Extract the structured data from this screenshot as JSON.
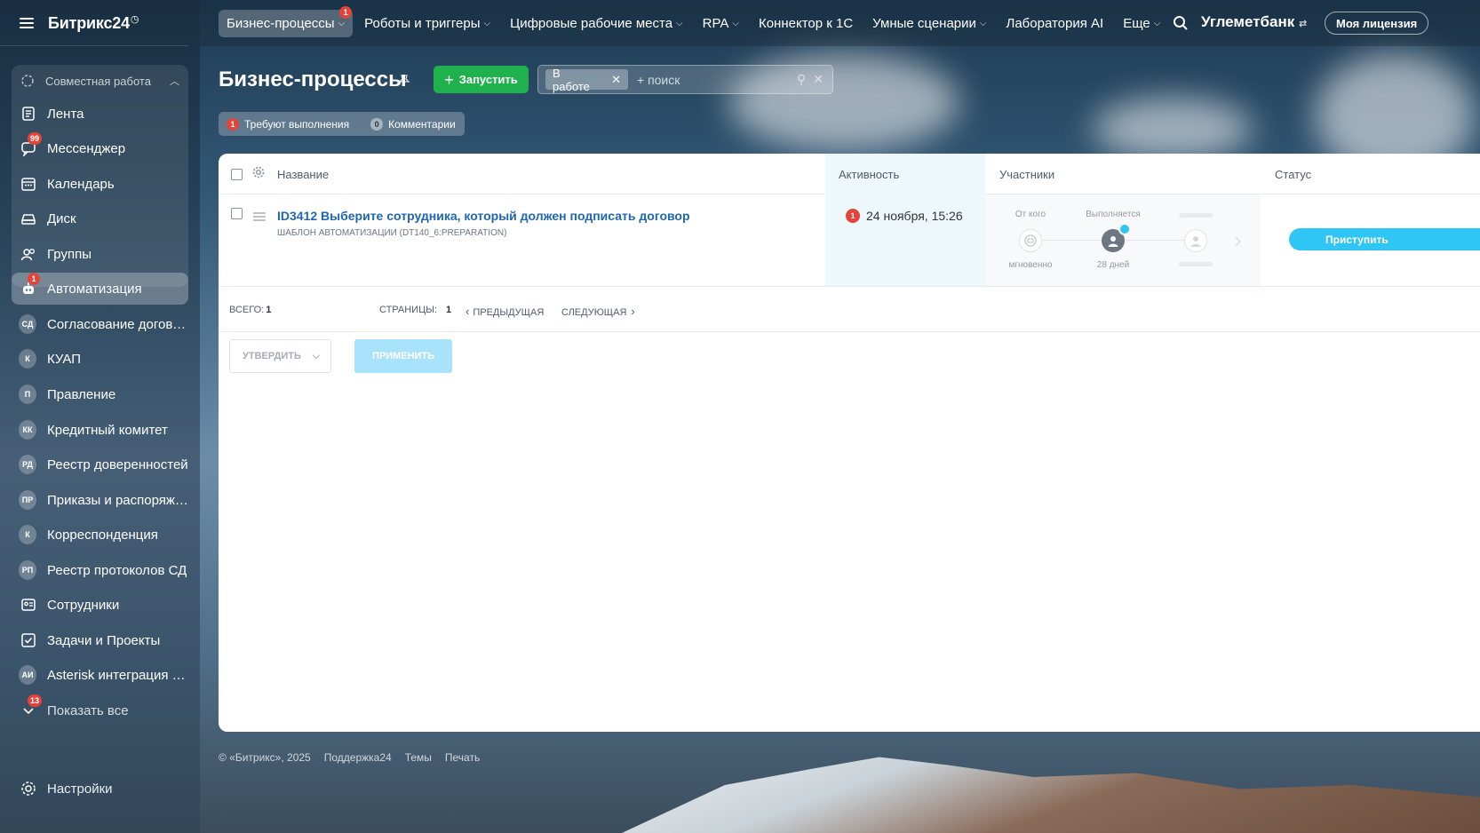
{
  "app": {
    "logo": "Битрикс24",
    "company": "Углеметбанк",
    "license_label": "Моя лицензия"
  },
  "topnav": {
    "items": [
      {
        "label": "Бизнес-процессы",
        "badge": "1",
        "active": true,
        "chevron": true
      },
      {
        "label": "Роботы и триггеры",
        "chevron": true
      },
      {
        "label": "Цифровые рабочие места",
        "chevron": true
      },
      {
        "label": "RPA",
        "chevron": true
      },
      {
        "label": "Коннектор к 1С",
        "chevron": false
      },
      {
        "label": "Умные сценарии",
        "chevron": true
      },
      {
        "label": "Лаборатория AI",
        "chevron": false
      },
      {
        "label": "Еще",
        "chevron": true
      }
    ]
  },
  "sidebar": {
    "group_label": "Совместная работа",
    "items": [
      {
        "label": "Лента",
        "icon": "feed-icon"
      },
      {
        "label": "Мессенджер",
        "icon": "messenger-icon",
        "badge": "99"
      },
      {
        "label": "Календарь",
        "icon": "calendar-icon"
      },
      {
        "label": "Диск",
        "icon": "disk-icon"
      },
      {
        "label": "Группы",
        "icon": "groups-icon"
      },
      {
        "label": "Автоматизация",
        "icon": "automation-icon",
        "badge": "1",
        "active": true
      },
      {
        "label": "Согласование догово...",
        "abbr": "СД"
      },
      {
        "label": "КУАП",
        "abbr": "К"
      },
      {
        "label": "Правление",
        "abbr": "П"
      },
      {
        "label": "Кредитный комитет",
        "abbr": "КК"
      },
      {
        "label": "Реестр доверенностей",
        "abbr": "РД"
      },
      {
        "label": "Приказы и распоряже...",
        "abbr": "ПР"
      },
      {
        "label": "Корреспонденция",
        "abbr": "К"
      },
      {
        "label": "Реестр протоколов СД",
        "abbr": "РП"
      },
      {
        "label": "Сотрудники",
        "icon": "employees-icon"
      },
      {
        "label": "Задачи и Проекты",
        "icon": "tasks-icon"
      },
      {
        "label": "Asterisk интеграция It...",
        "abbr": "АИ"
      },
      {
        "label": "Показать все",
        "icon": "chevron-down-icon",
        "badge": "13"
      }
    ],
    "settings_label": "Настройки"
  },
  "page": {
    "title": "Бизнес-процессы",
    "run_button": "Запустить",
    "filter_chip": "В работе",
    "search_placeholder": "+ поиск",
    "counters": [
      {
        "count": "1",
        "label": "Требуют выполнения",
        "color": "#e2443a"
      },
      {
        "count": "0",
        "label": "Комментарии"
      }
    ]
  },
  "grid": {
    "columns": {
      "name": "Название",
      "activity": "Активность",
      "participants": "Участники",
      "status": "Статус"
    },
    "row": {
      "title": "ID3412 Выберите сотрудника, который должен подписать договор",
      "subtitle": "ШАБЛОН АВТОМАТИЗАЦИИ (DT140_6:PREPARATION)",
      "activity_badge": "1",
      "activity_date": "24 ноября, 15:26",
      "from_label": "От кого",
      "from_time": "мгновенно",
      "executing_label": "Выполняется",
      "executing_time": "28 дней",
      "action_button": "Приступить"
    },
    "pager": {
      "total_label": "ВСЕГО:",
      "total_value": "1",
      "pages_label": "СТРАНИЦЫ:",
      "pages_value": "1",
      "prev": "ПРЕДЫДУЩАЯ",
      "next": "СЛЕДУЮЩАЯ"
    },
    "bulk": {
      "select_value": "УТВЕРДИТЬ",
      "apply": "ПРИМЕНИТЬ"
    }
  },
  "footer": {
    "copyright": "© «Битрикс», 2025",
    "links": [
      "Поддержка24",
      "Темы",
      "Печать"
    ]
  },
  "colors": {
    "accent_green": "#1fb14e",
    "accent_blue": "#2fc6f6",
    "link": "#2067b0",
    "badge_red": "#e2443a"
  }
}
